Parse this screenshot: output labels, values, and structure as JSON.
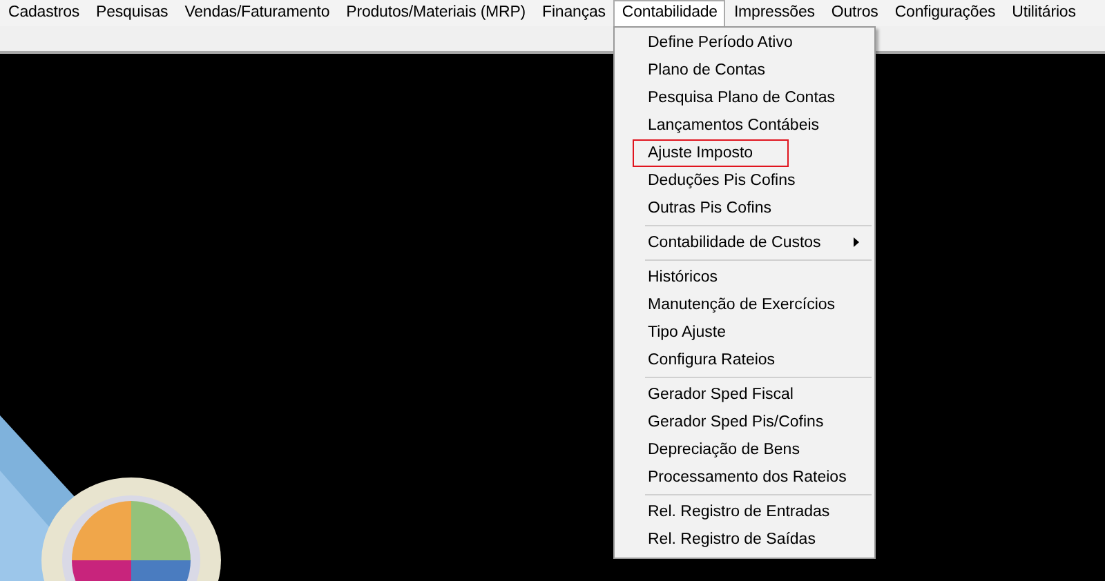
{
  "menu_bar": [
    {
      "label": "Cadastros",
      "selected": false
    },
    {
      "label": "Pesquisas",
      "selected": false
    },
    {
      "label": "Vendas/Faturamento",
      "selected": false
    },
    {
      "label": "Produtos/Materiais (MRP)",
      "selected": false
    },
    {
      "label": "Finanças",
      "selected": false
    },
    {
      "label": "Contabilidade",
      "selected": true
    },
    {
      "label": "Impressões",
      "selected": false
    },
    {
      "label": "Outros",
      "selected": false
    },
    {
      "label": "Configurações",
      "selected": false
    },
    {
      "label": "Utilitários",
      "selected": false
    }
  ],
  "dropdown": {
    "sections": [
      [
        {
          "label": "Define Período Ativo",
          "highlighted": false,
          "has_submenu": false
        },
        {
          "label": "Plano de Contas",
          "highlighted": false,
          "has_submenu": false
        },
        {
          "label": "Pesquisa Plano de Contas",
          "highlighted": false,
          "has_submenu": false
        },
        {
          "label": "Lançamentos Contábeis",
          "highlighted": false,
          "has_submenu": false
        },
        {
          "label": "Ajuste Imposto",
          "highlighted": true,
          "has_submenu": false
        },
        {
          "label": "Deduções Pis Cofins",
          "highlighted": false,
          "has_submenu": false
        },
        {
          "label": "Outras Pis Cofins",
          "highlighted": false,
          "has_submenu": false
        }
      ],
      [
        {
          "label": "Contabilidade de Custos",
          "highlighted": false,
          "has_submenu": true
        }
      ],
      [
        {
          "label": "Históricos",
          "highlighted": false,
          "has_submenu": false
        },
        {
          "label": "Manutenção de Exercícios",
          "highlighted": false,
          "has_submenu": false
        },
        {
          "label": "Tipo Ajuste",
          "highlighted": false,
          "has_submenu": false
        },
        {
          "label": "Configura Rateios",
          "highlighted": false,
          "has_submenu": false
        }
      ],
      [
        {
          "label": "Gerador Sped Fiscal",
          "highlighted": false,
          "has_submenu": false
        },
        {
          "label": "Gerador Sped Pis/Cofins",
          "highlighted": false,
          "has_submenu": false
        },
        {
          "label": "Depreciação de Bens",
          "highlighted": false,
          "has_submenu": false
        },
        {
          "label": "Processamento dos Rateios",
          "highlighted": false,
          "has_submenu": false
        }
      ],
      [
        {
          "label": "Rel. Registro de Entradas",
          "highlighted": false,
          "has_submenu": false
        },
        {
          "label": "Rel. Registro de Saídas",
          "highlighted": false,
          "has_submenu": false
        }
      ]
    ]
  }
}
